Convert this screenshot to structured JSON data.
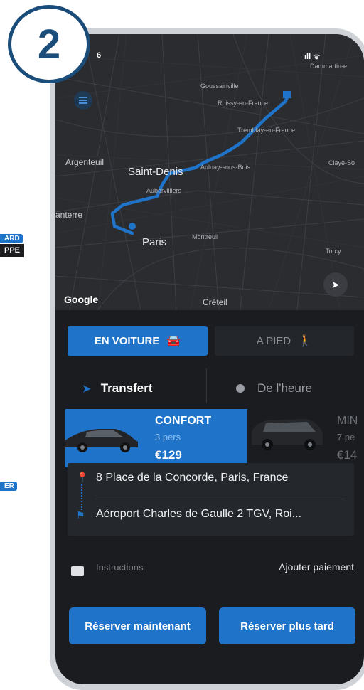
{
  "step_badge": "2",
  "left_fragments": [
    "ARD",
    "PPE",
    "ER"
  ],
  "status_bar": {
    "time": "6",
    "signal": "ıll ᯤ"
  },
  "map": {
    "places": [
      {
        "key": "goussainville",
        "label": "Goussainville"
      },
      {
        "key": "roissy",
        "label": "Roissy-en-France"
      },
      {
        "key": "dammartin",
        "label": "Dammartin-e"
      },
      {
        "key": "tremblay",
        "label": "Tremblay-en-France"
      },
      {
        "key": "argenteuil",
        "label": "Argenteuil"
      },
      {
        "key": "saint_denis",
        "label": "Saint-Denis"
      },
      {
        "key": "aulnay",
        "label": "Aulnay-sous-Bois"
      },
      {
        "key": "claye",
        "label": "Claye-So"
      },
      {
        "key": "aubervilliers",
        "label": "Aubervilliers"
      },
      {
        "key": "nanterre",
        "label": "anterre"
      },
      {
        "key": "paris",
        "label": "Paris"
      },
      {
        "key": "montreuil",
        "label": "Montreuil"
      },
      {
        "key": "torcy",
        "label": "Torcy"
      },
      {
        "key": "creteil",
        "label": "Créteil"
      }
    ],
    "attribution": "Google",
    "route_color": "#1f73c8"
  },
  "modes": {
    "car": "EN VOITURE",
    "walk": "A PIED"
  },
  "service_tabs": {
    "transfer": "Transfert",
    "hourly": "De l'heure"
  },
  "vehicles": [
    {
      "name": "CONFORT",
      "pax": "3 pers",
      "price": "€129",
      "selected": true
    },
    {
      "name": "MIN",
      "pax": "7 pe",
      "price": "€14",
      "selected": false
    }
  ],
  "route": {
    "pickup": "8 Place de la Concorde, Paris, France",
    "dropoff": "Aéroport Charles de Gaulle 2 TGV, Roi..."
  },
  "instructions_label": "Instructions",
  "add_payment": "Ajouter paiement",
  "actions": {
    "book_now": "Réserver maintenant",
    "book_later": "Réserver plus tard"
  },
  "colors": {
    "accent": "#1f73c8",
    "background": "#1a1c1f",
    "badge": "#1a4d7a"
  }
}
